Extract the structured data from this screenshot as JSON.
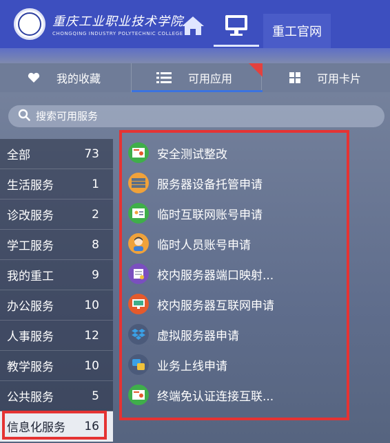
{
  "header": {
    "logo_cn": "重庆工业职业技术学院",
    "logo_en": "CHONGQING INDUSTRY POLYTECHNIC COLLEGE",
    "official_site": "重工官网",
    "icons": [
      "home-icon",
      "monitor-icon"
    ]
  },
  "tabs": [
    {
      "label": "我的收藏",
      "icon": "heart-icon"
    },
    {
      "label": "可用应用",
      "icon": "list-icon",
      "active": true
    },
    {
      "label": "可用卡片",
      "icon": "grid-icon"
    }
  ],
  "search": {
    "placeholder": "搜索可用服务",
    "icon": "search-icon"
  },
  "categories": [
    {
      "label": "全部",
      "count": "73"
    },
    {
      "label": "生活服务",
      "count": "1"
    },
    {
      "label": "诊改服务",
      "count": "2"
    },
    {
      "label": "学工服务",
      "count": "8"
    },
    {
      "label": "我的重工",
      "count": "9"
    },
    {
      "label": "办公服务",
      "count": "10"
    },
    {
      "label": "人事服务",
      "count": "12"
    },
    {
      "label": "教学服务",
      "count": "10"
    },
    {
      "label": "公共服务",
      "count": "5"
    },
    {
      "label": "信息化服务",
      "count": "16",
      "active": true
    }
  ],
  "apps": [
    {
      "label": "安全测试整改",
      "icon": "certificate-icon",
      "color": "#3fae4a"
    },
    {
      "label": "服务器设备托管申请",
      "icon": "server-icon",
      "color": "#f0a23a"
    },
    {
      "label": "临时互联网账号申请",
      "icon": "id-card-icon",
      "color": "#3fae4a"
    },
    {
      "label": "临时人员账号申请",
      "icon": "person-icon",
      "color": "#f0a23a"
    },
    {
      "label": "校内服务器端口映射...",
      "icon": "document-icon",
      "color": "#7a4fbf"
    },
    {
      "label": "校内服务器互联网申请",
      "icon": "monitor-icon",
      "color": "#e45a2c"
    },
    {
      "label": "虚拟服务器申请",
      "icon": "dropbox-icon",
      "color": "#4b5a7a"
    },
    {
      "label": "业务上线申请",
      "icon": "chat-icon",
      "color": "#4b5a7a"
    },
    {
      "label": "终端免认证连接互联...",
      "icon": "certificate-icon",
      "color": "#3fae4a"
    }
  ],
  "colors": {
    "header": "#3d4fbf",
    "highlight": "#e53333",
    "active_tab_line": "#3b73e0"
  }
}
